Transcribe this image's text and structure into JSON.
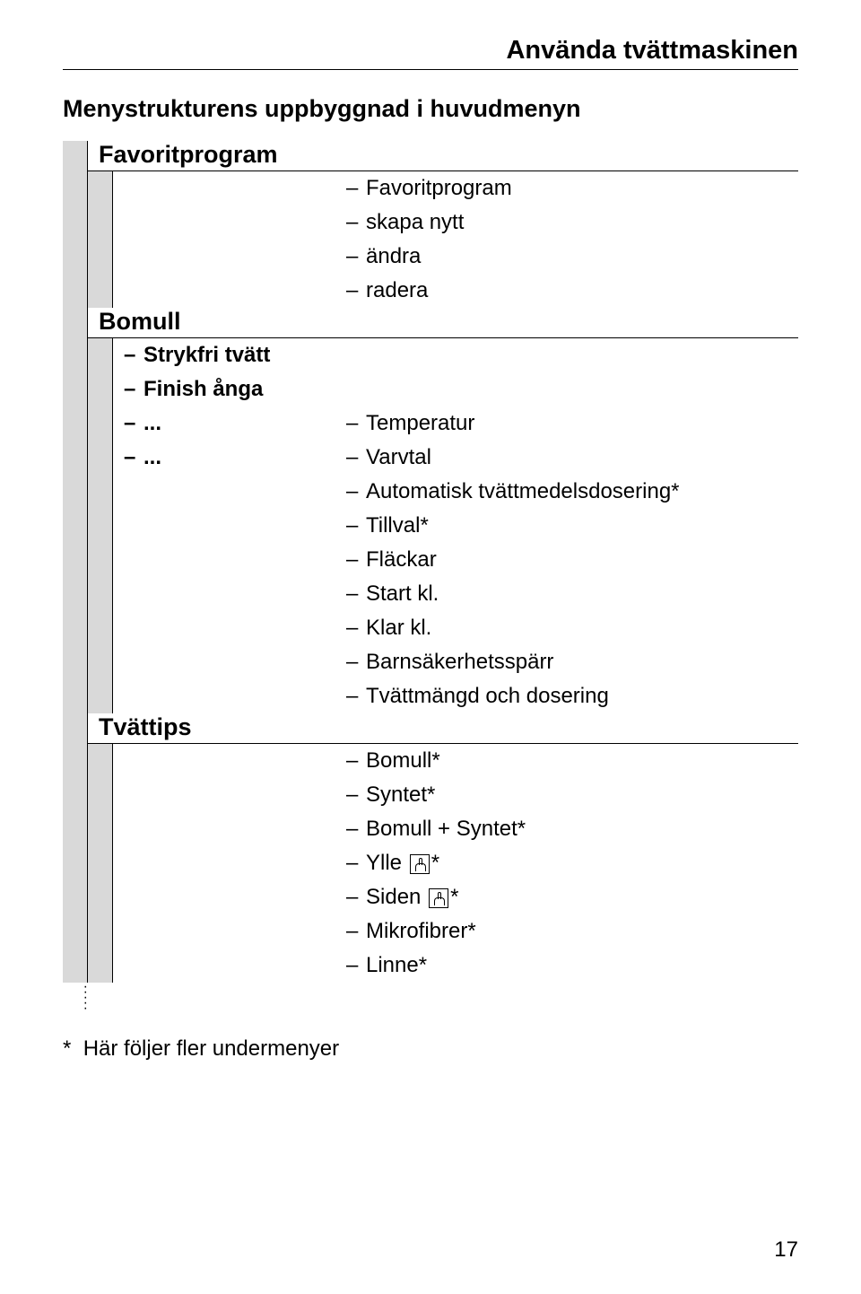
{
  "page_title": "Använda tvättmaskinen",
  "section_heading": "Menystrukturens uppbyggnad i huvudmenyn",
  "menu": {
    "favoritprogram": {
      "label": "Favoritprogram",
      "items": [
        "Favoritprogram",
        "skapa nytt",
        "ändra",
        "radera"
      ]
    },
    "bomull": {
      "label": "Bomull",
      "sub": {
        "strykfri": "Strykfri tvätt",
        "finish": "Finish ånga",
        "d1": "...",
        "d2": "..."
      },
      "right": {
        "temperatur": "Temperatur",
        "varvtal": "Varvtal",
        "auto": "Automatisk tvättmedelsdosering*",
        "tillval": "Tillval*",
        "flackar": "Fläckar",
        "startkl": "Start kl.",
        "klarkl": "Klar kl.",
        "barnsakerhet": "Barnsäkerhetsspärr",
        "tvattmangd": "Tvättmängd och dosering"
      }
    },
    "tvattips": {
      "label": "Tvättips",
      "items": {
        "bomull": "Bomull*",
        "syntet": "Syntet*",
        "bomull_syntet": "Bomull + Syntet*",
        "ylle_pre": "Ylle ",
        "ylle_post": "*",
        "siden_pre": "Siden ",
        "siden_post": "*",
        "mikrofibrer": "Mikrofibrer*",
        "linne": "Linne*"
      }
    }
  },
  "footnote_marker": "*",
  "footnote_text": "Här följer fler undermenyer",
  "page_number": "17"
}
